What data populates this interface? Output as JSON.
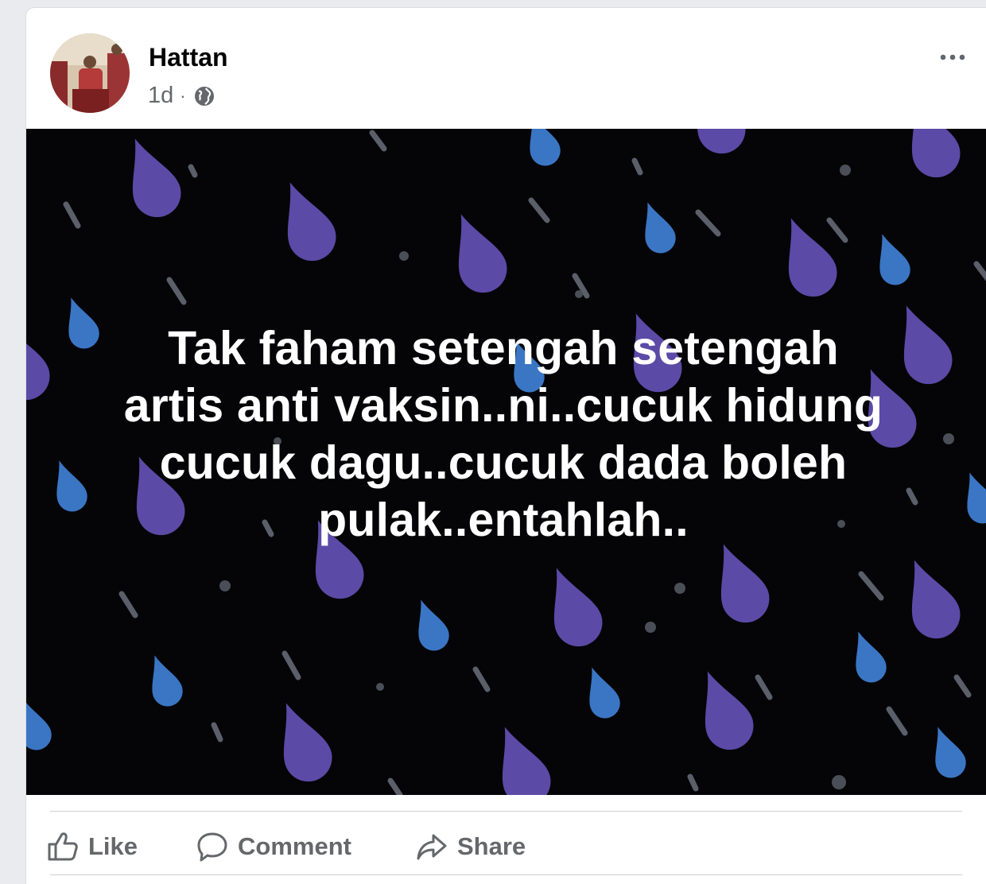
{
  "post": {
    "author": "Hattan",
    "time": "1d",
    "separator": "·",
    "privacy_icon": "globe-icon",
    "more_icon": "more-options-icon",
    "text_lines": [
      "Tak faham setengah setengah",
      "artis anti vaksin..ni..cucuk hidung",
      "cucuk dagu..cucuk dada boleh",
      "pulak..entahlah.."
    ]
  },
  "actions": {
    "like_label": "Like",
    "comment_label": "Comment",
    "share_label": "Share"
  },
  "colors": {
    "background": "#050507",
    "drop_purple": "#5b4aa6",
    "drop_blue": "#3a76c4",
    "streak_grey": "#5a5f6a",
    "action_text": "#65676b"
  }
}
